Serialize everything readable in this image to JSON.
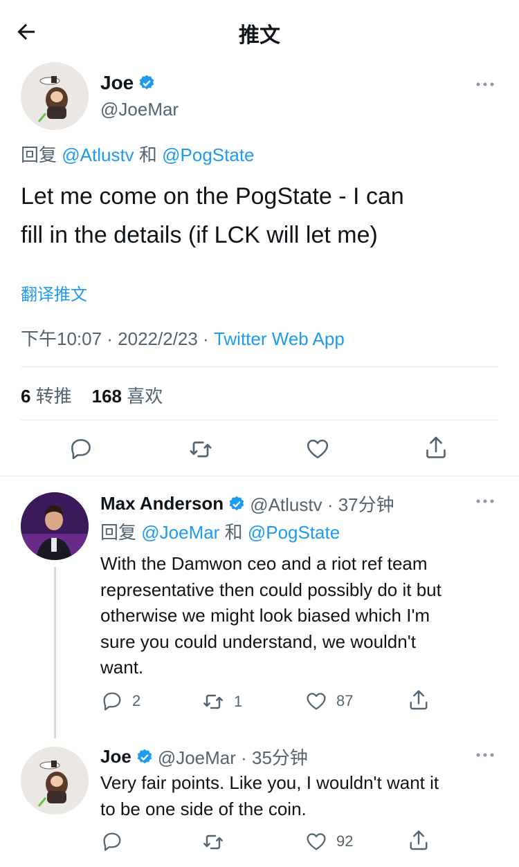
{
  "header": {
    "title": "推文"
  },
  "main_tweet": {
    "name": "Joe",
    "handle": "@JoeMar",
    "reply_prefix": "回复",
    "reply_user1": "@Atlustv",
    "reply_and": "和",
    "reply_user2": "@PogState",
    "text_line1": "Let me come on the PogState - I can",
    "text_line2": "fill in the details (if LCK will let me)",
    "translate": "翻译推文",
    "time": "下午10:07 · 2022/2/23 · ",
    "source": "Twitter Web App",
    "retweets_count": "6",
    "retweets_label": "转推",
    "likes_count": "168",
    "likes_label": "喜欢"
  },
  "replies": [
    {
      "name": "Max Anderson",
      "handle_time": "@Atlustv · 37分钟",
      "reply_prefix": "回复",
      "reply_user1": "@JoeMar",
      "reply_and": "和",
      "reply_user2": "@PogState",
      "lines": [
        "With the Damwon ceo and a riot ref team",
        "representative then could possibly do it but",
        "otherwise we might look biased which I'm",
        "sure you could understand, we wouldn't",
        "want."
      ],
      "reply_count": "2",
      "retweet_count": "1",
      "like_count": "87"
    },
    {
      "name": "Joe",
      "handle_time": "@JoeMar · 35分钟",
      "lines": [
        "Very fair points.  Like you, I wouldn't want it",
        "to be one side of the coin."
      ],
      "like_count": "92"
    }
  ],
  "colors": {
    "accent": "#1d9bf0",
    "text": "#0f1419",
    "secondary": "#536471",
    "divider": "#e7e9ea"
  },
  "icons": [
    "back-arrow-icon",
    "verified-icon",
    "more-icon",
    "reply-icon",
    "retweet-icon",
    "like-icon",
    "share-icon"
  ]
}
